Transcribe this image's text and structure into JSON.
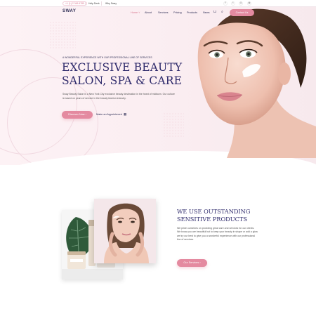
{
  "topbar": {
    "phone": "+1 (1) 2 345 6789",
    "links": [
      "Help Desk",
      "Why Sway"
    ],
    "social_icons": [
      "facebook-icon",
      "twitter-icon",
      "instagram-icon",
      "globe-icon"
    ]
  },
  "brand": {
    "logo": "SWAY"
  },
  "nav": {
    "items": [
      "Home",
      "About",
      "Services",
      "Pricing",
      "Products",
      "News"
    ],
    "active": "Home",
    "contact_label": "Contact Us"
  },
  "hero": {
    "kicker": "A WONDERFUL EXPERIENCE WITH OUR PROFESSIONAL LINE OF SERVICES",
    "title_line1": "EXCLUSIVE BEAUTY",
    "title_line2": "SALON, SPA & CARE",
    "description": "Sway Beauty Salon is a New York City exclusive beauty destination in the heart of midtown. Our culture is based on years of service in the beauty fashion industry.",
    "primary_button": "Discover Now",
    "secondary_link": "Make an Appointment"
  },
  "feature": {
    "title_line1": "WE USE OUTSTANDING",
    "title_line2": "SENSITIVE PRODUCTS",
    "description": "We pride ourselves on providing great care and services for our clients. We know you are beautiful but to keep your beauty in shape or add a glow we try our best to give you a wonderful experience with our professional line of services.",
    "button": "Our Services"
  },
  "colors": {
    "accent": "#e48aa0",
    "heading": "#2e2a6b",
    "hero_bg": "#fbeef2"
  }
}
